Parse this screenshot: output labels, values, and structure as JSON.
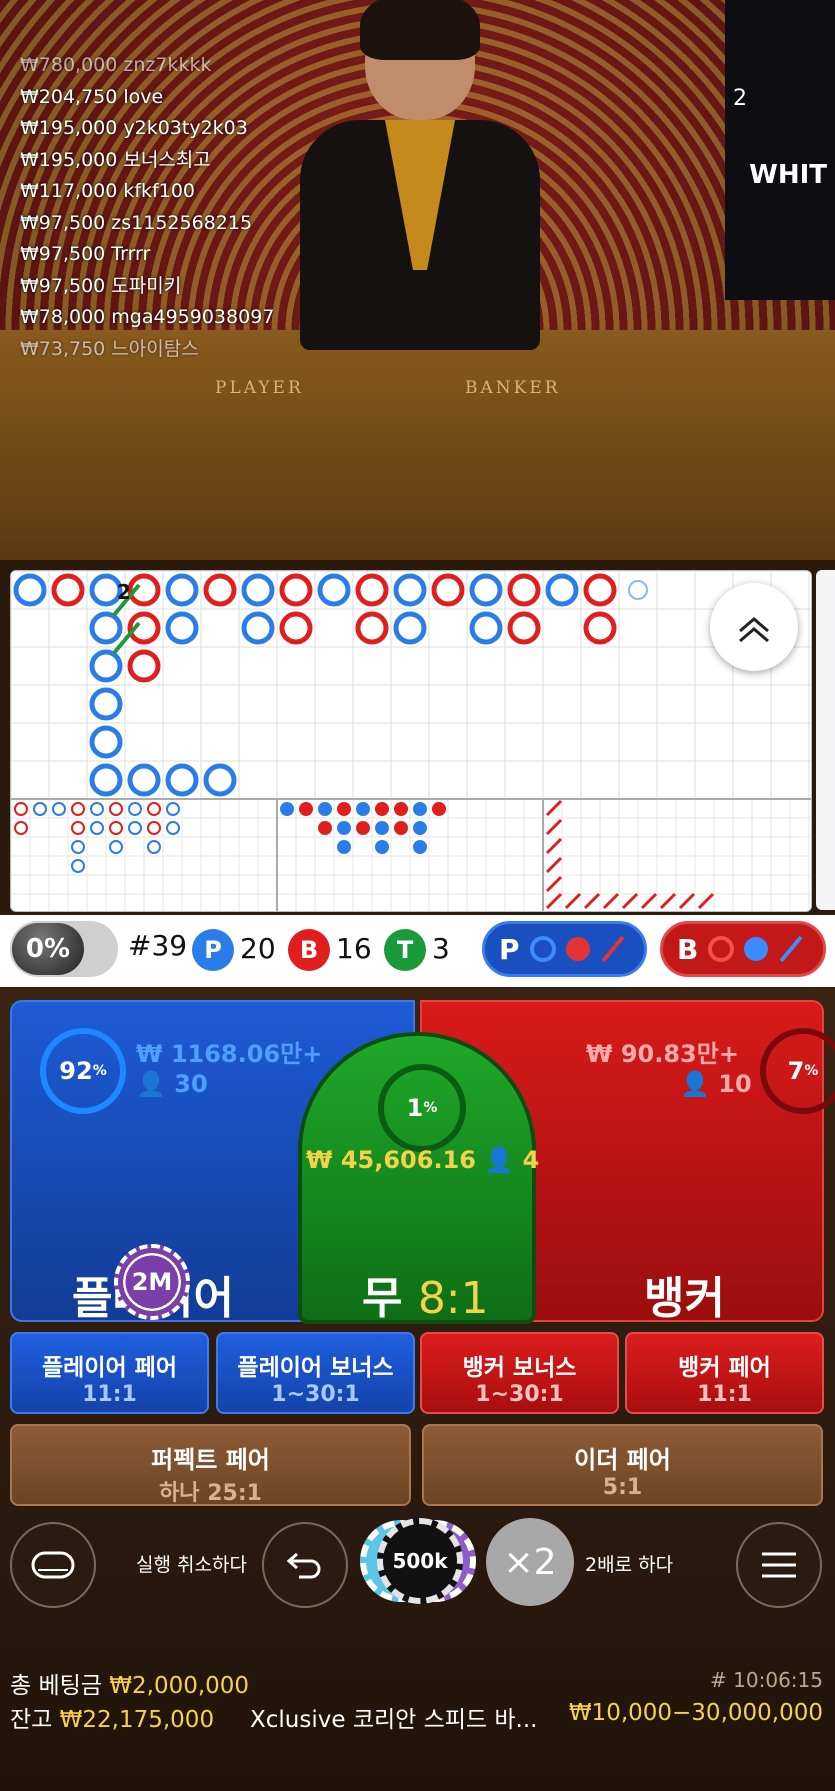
{
  "video": {
    "felt_player": "PLAYER",
    "felt_banker": "BANKER",
    "side_screen_text": "WHIT",
    "counter": "2"
  },
  "winners": [
    {
      "amount": "₩780,000",
      "name": "znz7kkkk"
    },
    {
      "amount": "₩204,750",
      "name": "love"
    },
    {
      "amount": "₩195,000",
      "name": "y2k03ty2k03"
    },
    {
      "amount": "₩195,000",
      "name": "보너스최고"
    },
    {
      "amount": "₩117,000",
      "name": "kfkf100"
    },
    {
      "amount": "₩97,500",
      "name": "zs1152568215"
    },
    {
      "amount": "₩97,500",
      "name": "Trrrr"
    },
    {
      "amount": "₩97,500",
      "name": "도파미키"
    },
    {
      "amount": "₩78,000",
      "name": "mga4959038097"
    },
    {
      "amount": "₩73,750",
      "name": "느아이탐스"
    }
  ],
  "roadmap": {
    "marker_number": "2"
  },
  "stats": {
    "percent_toggle": "0%",
    "round": "#39",
    "player_badge": "P",
    "player_count": "20",
    "banker_badge": "B",
    "banker_count": "16",
    "tie_badge": "T",
    "tie_count": "3",
    "predict_player": "P",
    "predict_banker": "B"
  },
  "bets": {
    "player": {
      "percent": "92",
      "pool": "₩ 1168.06만+",
      "users": "30",
      "label": "플레이어",
      "chip": "2M"
    },
    "tie": {
      "percent": "1",
      "pool": "₩ 45,606.16",
      "users": "4",
      "label": "무",
      "odds": "8:1"
    },
    "banker": {
      "percent": "7",
      "pool": "₩ 90.83만+",
      "users": "10",
      "label": "뱅커"
    }
  },
  "side_bets": [
    {
      "title": "플레이어 페어",
      "odds": "11:1"
    },
    {
      "title": "플레이어 보너스",
      "odds": "1~30:1"
    },
    {
      "title": "뱅커 보너스",
      "odds": "1~30:1"
    },
    {
      "title": "뱅커 페어",
      "odds": "11:1"
    }
  ],
  "pair_bets": [
    {
      "title": "퍼펙트 페어",
      "odds": "하나 25:1"
    },
    {
      "title": "이더 페어",
      "odds": "5:1"
    }
  ],
  "controls": {
    "undo_label": "실행 취소하다",
    "chip_value": "500k",
    "double": "×2",
    "double_label": "2배로 하다"
  },
  "footer": {
    "total_bet_label": "총 베팅금",
    "total_bet": "₩2,000,000",
    "balance_label": "잔고",
    "balance": "₩22,175,000",
    "table_name": "Xclusive 코리안 스피드 바...",
    "limits": "₩10,000−30,000,000",
    "round_time": "# 10:06:15"
  },
  "colors": {
    "player_blue": "#1e5bd6",
    "banker_red": "#d91a1a",
    "tie_green": "#1fa82a",
    "gold": "#f6d24a"
  }
}
